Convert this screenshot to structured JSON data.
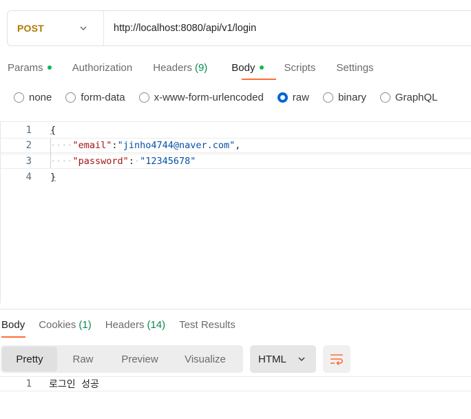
{
  "request": {
    "method": "POST",
    "url": "http://localhost:8080/api/v1/login"
  },
  "request_tabs": [
    {
      "label": "Params",
      "dot": true
    },
    {
      "label": "Authorization"
    },
    {
      "label": "Headers",
      "count": "(9)"
    },
    {
      "label": "Body",
      "dot": true,
      "active": true
    },
    {
      "label": "Scripts"
    },
    {
      "label": "Settings"
    }
  ],
  "body_types": [
    "none",
    "form-data",
    "x-www-form-urlencoded",
    "raw",
    "binary",
    "GraphQL"
  ],
  "body_type_selected": "raw",
  "editor": {
    "line_numbers": [
      "1",
      "2",
      "3",
      "4"
    ],
    "open_brace": "{",
    "close_brace": "}",
    "lines": [
      {
        "key": "\"email\"",
        "sep": ":",
        "value": "\"jinho4744@naver.com\"",
        "trail": ","
      },
      {
        "key": "\"password\"",
        "sep": ":",
        "value": "\"12345678\"",
        "trail": ""
      }
    ]
  },
  "response_tabs": [
    {
      "label": "Body",
      "active": true
    },
    {
      "label": "Cookies",
      "count": "(1)"
    },
    {
      "label": "Headers",
      "count": "(14)"
    },
    {
      "label": "Test Results"
    }
  ],
  "view_modes": [
    "Pretty",
    "Raw",
    "Preview",
    "Visualize"
  ],
  "view_mode_active": "Pretty",
  "format": "HTML",
  "response_body": {
    "line_number": "1",
    "text": "로그인 성공"
  },
  "colors": {
    "accent": "#ff6c37",
    "method": "#ad7a03",
    "status_dot": "#0cbb52",
    "radio_selected": "#0265d2"
  },
  "icons": [
    "chevron-down-icon",
    "wrap-lines-icon"
  ]
}
